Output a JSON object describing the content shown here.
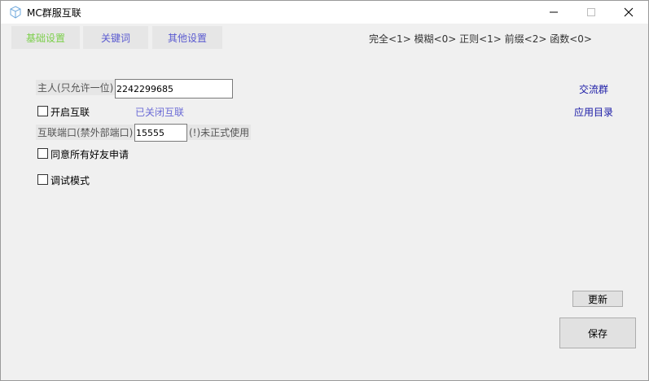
{
  "window": {
    "title": "MC群服互联"
  },
  "tabs": [
    {
      "label": "基础设置",
      "active": true
    },
    {
      "label": "关键词",
      "active": false
    },
    {
      "label": "其他设置",
      "active": false
    }
  ],
  "match_legend": "完全<1> 模糊<0> 正则<1> 前缀<2> 函数<0>",
  "owner": {
    "label": "主人(只允许一位)",
    "value": "2242299685"
  },
  "interconnect": {
    "label": "开启互联",
    "checked": false,
    "status": "已关闭互联"
  },
  "port": {
    "label": "互联端口(禁外部端口)",
    "value": "15555",
    "note": "(!)未正式使用"
  },
  "accept_friends": {
    "label": "同意所有好友申请",
    "checked": false
  },
  "debug_mode": {
    "label": "调试模式",
    "checked": false
  },
  "links": {
    "group": "交流群",
    "app_dir": "应用目录"
  },
  "buttons": {
    "update": "更新",
    "save": "保存"
  },
  "colors": {
    "active_tab": "#7ccf4b",
    "inactive_tab": "#5a5ad0",
    "link": "#1a1aa6"
  }
}
